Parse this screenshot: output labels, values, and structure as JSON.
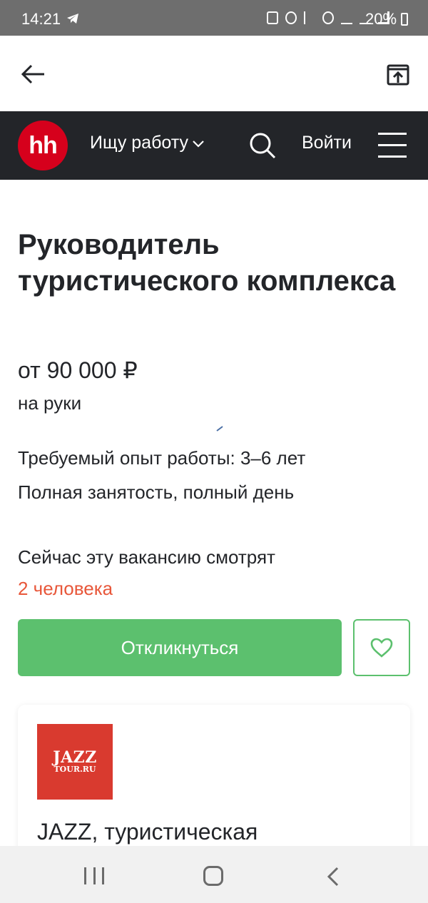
{
  "status_bar": {
    "time": "14:21",
    "battery": "20%"
  },
  "header": {
    "logo_text": "hh",
    "role_label": "Ищу работу",
    "login_label": "Войти"
  },
  "vacancy": {
    "title": "Руководитель туристического комплекса",
    "salary": "от 90 000 ₽",
    "salary_note": "на руки",
    "experience": "Требуемый опыт работы: 3–6 лет",
    "employment": "Полная занятость, полный день",
    "viewers_label": "Сейчас эту вакансию смотрят",
    "viewers_count": "2 человека"
  },
  "actions": {
    "apply_label": "Откликнуться"
  },
  "company": {
    "logo_line1": "JAZZ",
    "logo_line2": "TOUR.RU",
    "name": "JAZZ, туристическая"
  },
  "colors": {
    "header_bg": "#232529",
    "brand_red": "#d6001c",
    "apply_green": "#5cc06e",
    "highlight": "#e8573a",
    "company_logo_bg": "#d93a2f"
  },
  "icons": [
    "telegram-icon",
    "back-arrow-icon",
    "share-icon",
    "chevron-down-icon",
    "search-icon",
    "menu-icon",
    "heart-icon",
    "recents-icon",
    "home-icon",
    "nav-back-icon"
  ]
}
